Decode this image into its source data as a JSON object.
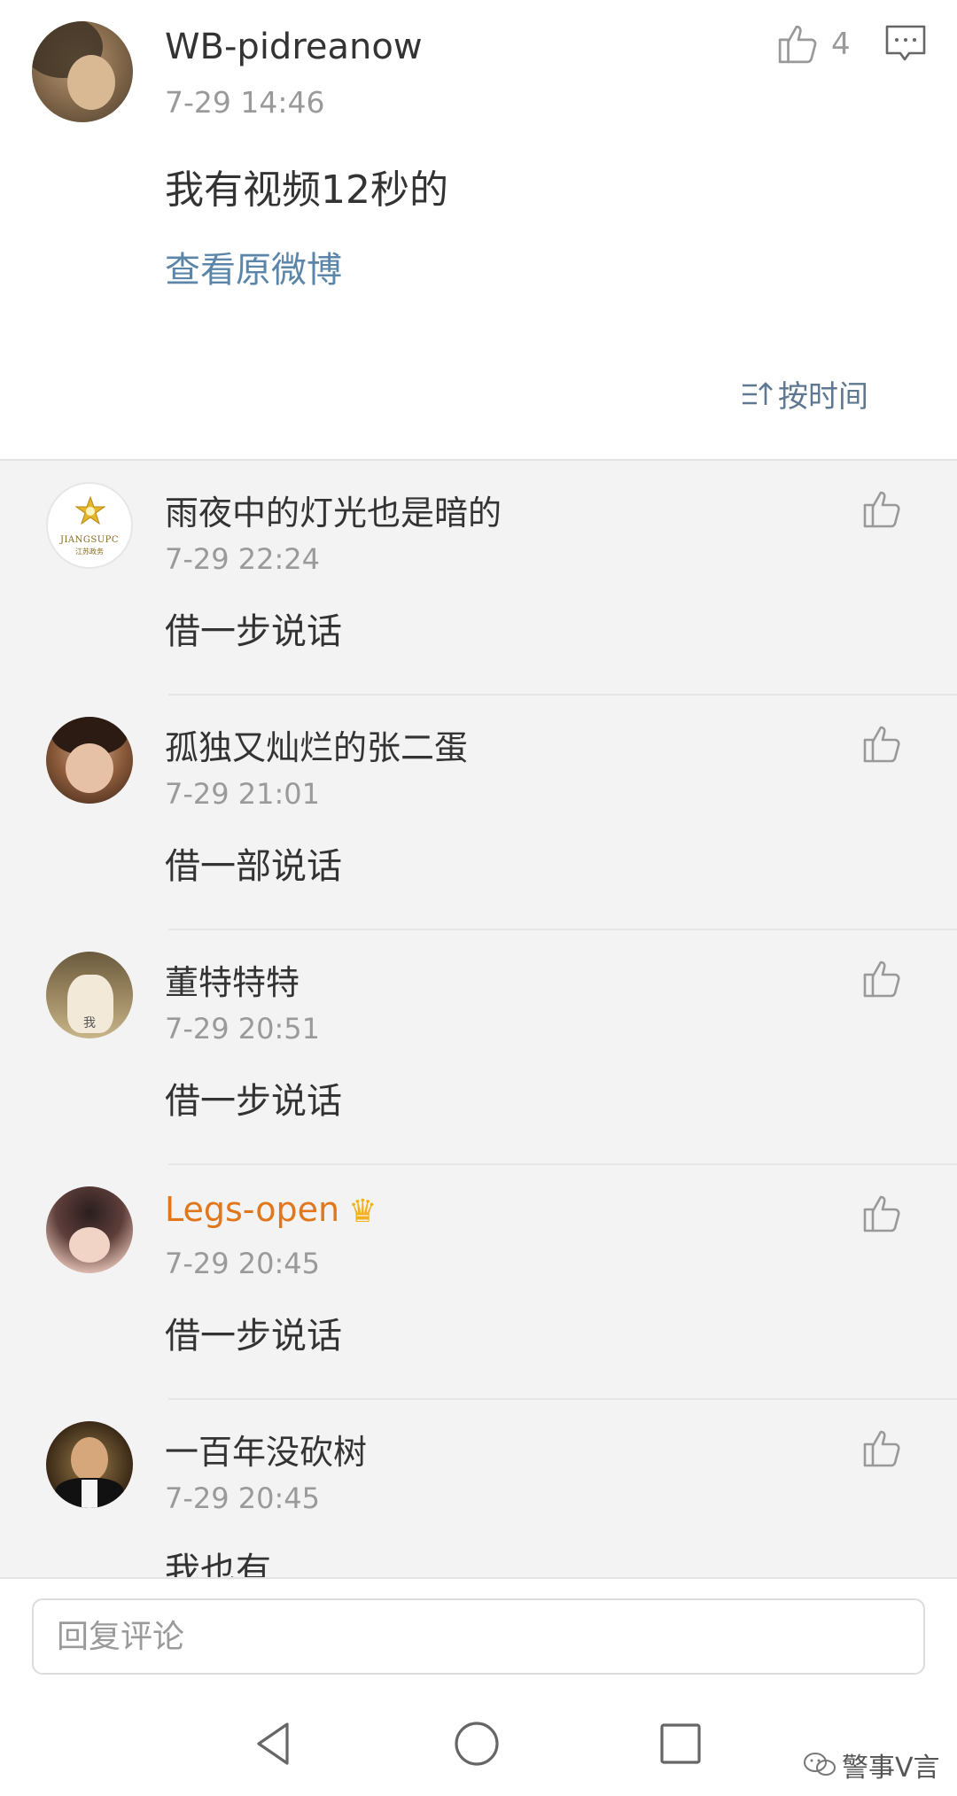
{
  "post": {
    "username": "WB-pidreanow",
    "time": "7-29 14:46",
    "text": "我有视频12秒的",
    "view_original": "查看原微博",
    "like_count": "4",
    "sort_label": "按时间"
  },
  "comments": [
    {
      "name": "雨夜中的灯光也是暗的",
      "time": "7-29 22:24",
      "text": "借一步说话",
      "avatar_text": "JIANGSUPC",
      "avatar_sub": "江苏政务"
    },
    {
      "name": "孤独又灿烂的张二蛋",
      "time": "7-29 21:01",
      "text": "借一部说话"
    },
    {
      "name": "董特特特",
      "time": "7-29 20:51",
      "text": "借一步说话",
      "avatar_text": "我"
    },
    {
      "name": "Legs-open",
      "time": "7-29 20:45",
      "text": "借一步说话",
      "badge": "♛"
    },
    {
      "name": "一百年没砍树",
      "time": "7-29 20:45",
      "text": "我也有"
    }
  ],
  "reply": {
    "placeholder": "回复评论"
  },
  "watermark": {
    "text": "警事V言"
  },
  "colors": {
    "link": "#5b86a9",
    "vip_name": "#e0771d",
    "muted": "#9a9a9a"
  }
}
